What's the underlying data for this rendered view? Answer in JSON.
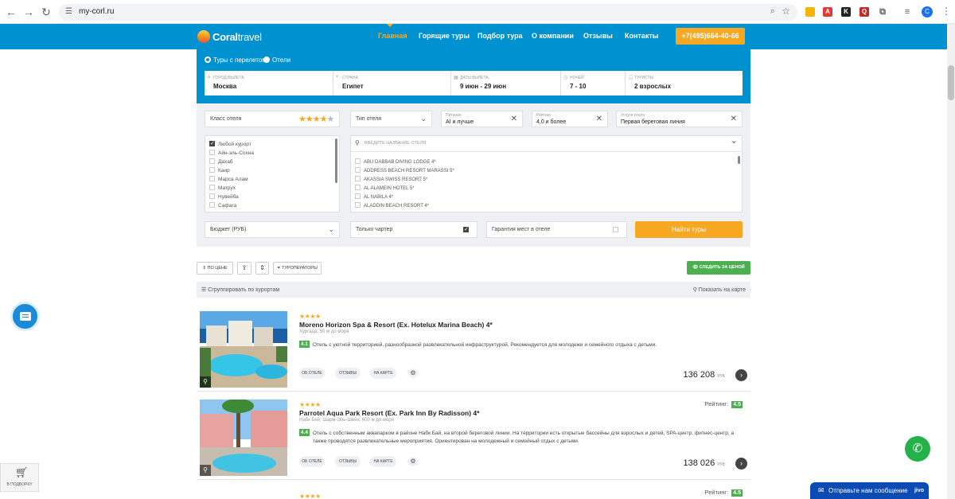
{
  "browser": {
    "url": "my-corl.ru",
    "profile_initial": "C"
  },
  "header": {
    "logo_bold": "Coral",
    "logo_light": "travel",
    "menu": [
      "Главная",
      "Горящие туры",
      "Подбор тура",
      "О компании",
      "Отзывы",
      "Контакты"
    ],
    "phone": "+7(495)664-40-66"
  },
  "search": {
    "mode_flight": "Туры с перелетом",
    "mode_hotels": "Отели",
    "fields": [
      {
        "label": "Город вылета",
        "value": "Москва"
      },
      {
        "label": "Страна",
        "value": "Египет"
      },
      {
        "label": "Даты вылета",
        "value": "9 июн - 29 июн"
      },
      {
        "label": "Ночей",
        "value": "7 - 10"
      },
      {
        "label": "Туристы",
        "value": "2 взрослых"
      }
    ]
  },
  "filters": {
    "hotel_class_label": "Класс отеля",
    "hotel_class_stars": 4,
    "hotel_type_label": "Тип отеля",
    "meal_label": "Питание",
    "meal_value": "AI и лучше",
    "rating_label": "Рейтинг",
    "rating_value": "4,0 и более",
    "services_label": "Услуги отеля",
    "services_value": "Первая береговая линия",
    "resorts": [
      "Любой курорт",
      "Айн-эль-Сохна",
      "Дахаб",
      "Каир",
      "Марса Алам",
      "Матрух",
      "Нувейба",
      "Сафага"
    ],
    "hotel_search_placeholder": "Введите название отеля",
    "hotels": [
      "ABU DABBAB DIVING LODGE 4*",
      "ADDRESS BEACH RESORT MARASSI 5*",
      "AKASSIA SWISS RESORT 5*",
      "AL ALAMEIN HOTEL 5*",
      "AL NABILA 4*",
      "ALADDIN BEACH RESORT 4*"
    ],
    "budget_label": "Бюджет (РУБ)",
    "charter_label": "Только чартер",
    "guarantee_label": "Гарантия мест в отеле",
    "find_button": "Найти туры"
  },
  "toolbar": {
    "sort_price": "ПО ЦЕНЕ",
    "operators": "ТУРОПЕРАТОРЫ",
    "follow_price": "СЛЕДИТЬ ЗА ЦЕНОЙ",
    "group_by": "Сгруппировать по курортам",
    "show_map": "Показать на карте"
  },
  "hotels": [
    {
      "stars": "★★★★",
      "name": "Moreno Horizon Spa & Resort (Ex. Hotelux Marina Beach) 4*",
      "location": "Хургада, 50 м до моря",
      "score": "4.1",
      "description": "Отель с уютной территорией, разнообразной развлекательной инфраструктурой. Рекомендуется для молодежи и семейного отдыха с детьми.",
      "price": "136 208",
      "currency": "РУБ",
      "rating_label": ""
    },
    {
      "stars": "★★★★",
      "name": "Parrotel Aqua Park Resort (Ex. Park Inn By Radisson) 4*",
      "location": "Набк Бей, Шарм-Эль-Шейх, 600 м до моря",
      "score": "4.4",
      "description": "Отель с собственным аквапарком в районе Набк Бай, на второй береговой линии. На территории есть открытые бассейны для взрослых и детей, SPA-центр, фитнес-центр, а также проводятся развлекательные мероприятия. Ориентирован на молодежный и семейный отдых с детьми.",
      "price": "138 026",
      "currency": "РУБ",
      "rating_label": "Рейтинг:",
      "rating_value": "4.5"
    },
    {
      "stars": "★★★★",
      "rating_label": "Рейтинг:",
      "rating_value": "4.5"
    }
  ],
  "card_actions": {
    "about": "ОБ ОТЕЛЕ",
    "reviews": "ОТЗЫВЫ",
    "map": "НА КАРТЕ"
  },
  "widgets": {
    "cart_label": "В ПОДБОРКУ",
    "jivo_text": "Отправьте нам сообщение",
    "jivo_brand": "jivo"
  }
}
